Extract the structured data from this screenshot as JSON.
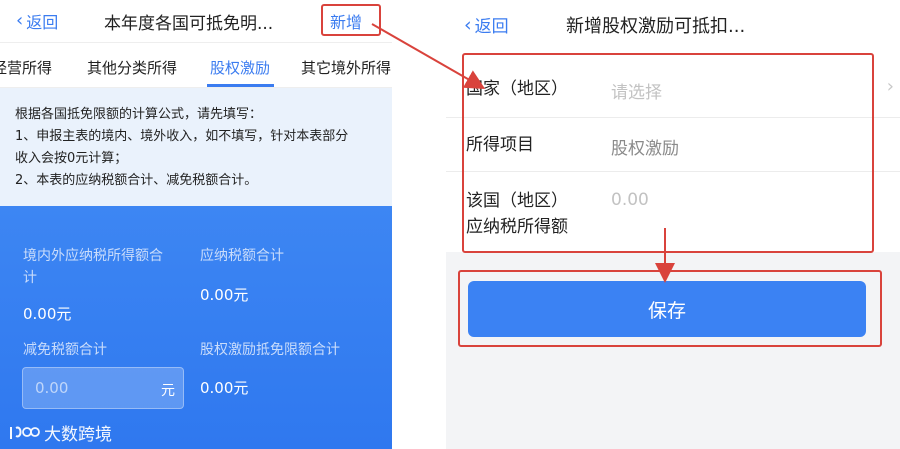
{
  "left": {
    "back_label": "返回",
    "title": "本年度各国可抵免明...",
    "add_label": "新增",
    "tabs": [
      "经营所得",
      "其他分类所得",
      "股权激励",
      "其它境外所得"
    ],
    "active_tab": "股权激励",
    "notice": [
      "根据各国抵免限额的计算公式，请先填写：",
      "1、申报主表的境内、境外收入，如不填写，针对本表部分",
      "收入会按0元计算；",
      "2、本表的应纳税额合计、减免税额合计。"
    ],
    "summary": {
      "taxable_income_label_line1": "境内外应纳税所得额合",
      "taxable_income_label_line2": "计",
      "taxable_income_value": "0.00元",
      "tax_payable_label": "应纳税额合计",
      "tax_payable_value": "0.00元",
      "tax_reduction_label": "减免税额合计",
      "tax_reduction_placeholder": "0.00",
      "tax_reduction_unit": "元",
      "equity_limit_label": "股权激励抵免限额合计",
      "equity_limit_value": "0.00元"
    },
    "watermark": "大数跨境"
  },
  "right": {
    "back_label": "返回",
    "title": "新增股权激励可抵扣...",
    "fields": {
      "country_label": "国家（地区）",
      "country_placeholder": "请选择",
      "income_item_label": "所得项目",
      "income_item_value": "股权激励",
      "taxable_income_label_line1": "该国（地区）",
      "taxable_income_label_line2": "应纳税所得额",
      "taxable_income_placeholder": "0.00"
    },
    "save_label": "保存"
  },
  "colors": {
    "accent": "#3b7cf0",
    "panel_blue": "#3d86f3",
    "annotation_red": "#d9433c",
    "notice_bg": "#eaf2fc"
  },
  "icons": {
    "back": "chevron-left-icon",
    "country_select": "chevron-right-icon",
    "watermark_logo": "logo-icon"
  }
}
